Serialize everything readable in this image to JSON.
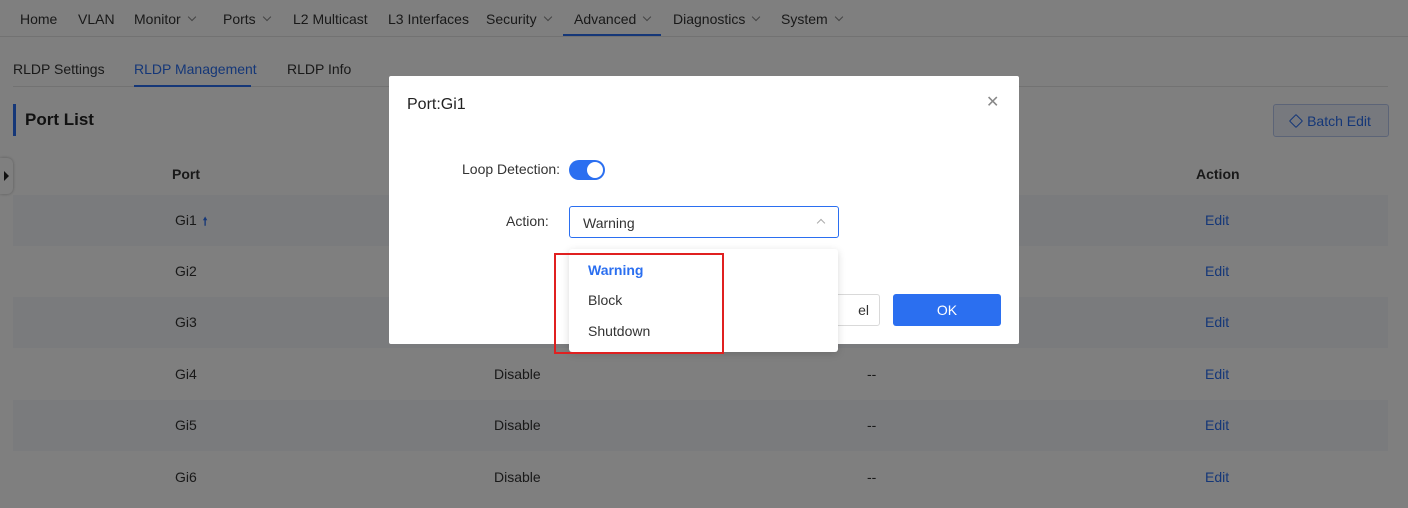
{
  "nav": {
    "items": [
      {
        "label": "Home",
        "has_menu": false
      },
      {
        "label": "VLAN",
        "has_menu": false
      },
      {
        "label": "Monitor",
        "has_menu": true
      },
      {
        "label": "Ports",
        "has_menu": true
      },
      {
        "label": "L2 Multicast",
        "has_menu": false
      },
      {
        "label": "L3 Interfaces",
        "has_menu": false
      },
      {
        "label": "Security",
        "has_menu": true
      },
      {
        "label": "Advanced",
        "has_menu": true,
        "active": true
      },
      {
        "label": "Diagnostics",
        "has_menu": true
      },
      {
        "label": "System",
        "has_menu": true
      }
    ]
  },
  "subtabs": [
    {
      "label": "RLDP Settings"
    },
    {
      "label": "RLDP Management",
      "active": true
    },
    {
      "label": "RLDP Info"
    }
  ],
  "section": {
    "title": "Port List",
    "batch_edit_label": "Batch Edit"
  },
  "table": {
    "headers": {
      "port": "Port",
      "action": "Action"
    },
    "rows": [
      {
        "port": "Gi1",
        "uplink": true,
        "loop": "",
        "action_value": "",
        "edit": "Edit"
      },
      {
        "port": "Gi2",
        "uplink": false,
        "loop": "",
        "action_value": "",
        "edit": "Edit"
      },
      {
        "port": "Gi3",
        "uplink": false,
        "loop": "",
        "action_value": "",
        "edit": "Edit"
      },
      {
        "port": "Gi4",
        "uplink": false,
        "loop": "Disable",
        "action_value": "--",
        "edit": "Edit"
      },
      {
        "port": "Gi5",
        "uplink": false,
        "loop": "Disable",
        "action_value": "--",
        "edit": "Edit"
      },
      {
        "port": "Gi6",
        "uplink": false,
        "loop": "Disable",
        "action_value": "--",
        "edit": "Edit"
      }
    ]
  },
  "modal": {
    "title": "Port:Gi1",
    "loop_detection_label": "Loop Detection:",
    "loop_detection_on": true,
    "action_label": "Action:",
    "action_value": "Warning",
    "cancel_label": "el",
    "ok_label": "OK"
  },
  "dropdown": {
    "options": [
      "Warning",
      "Block",
      "Shutdown"
    ],
    "selected": "Warning"
  },
  "colors": {
    "accent": "#2b6ff0",
    "highlight": "#e02020"
  }
}
